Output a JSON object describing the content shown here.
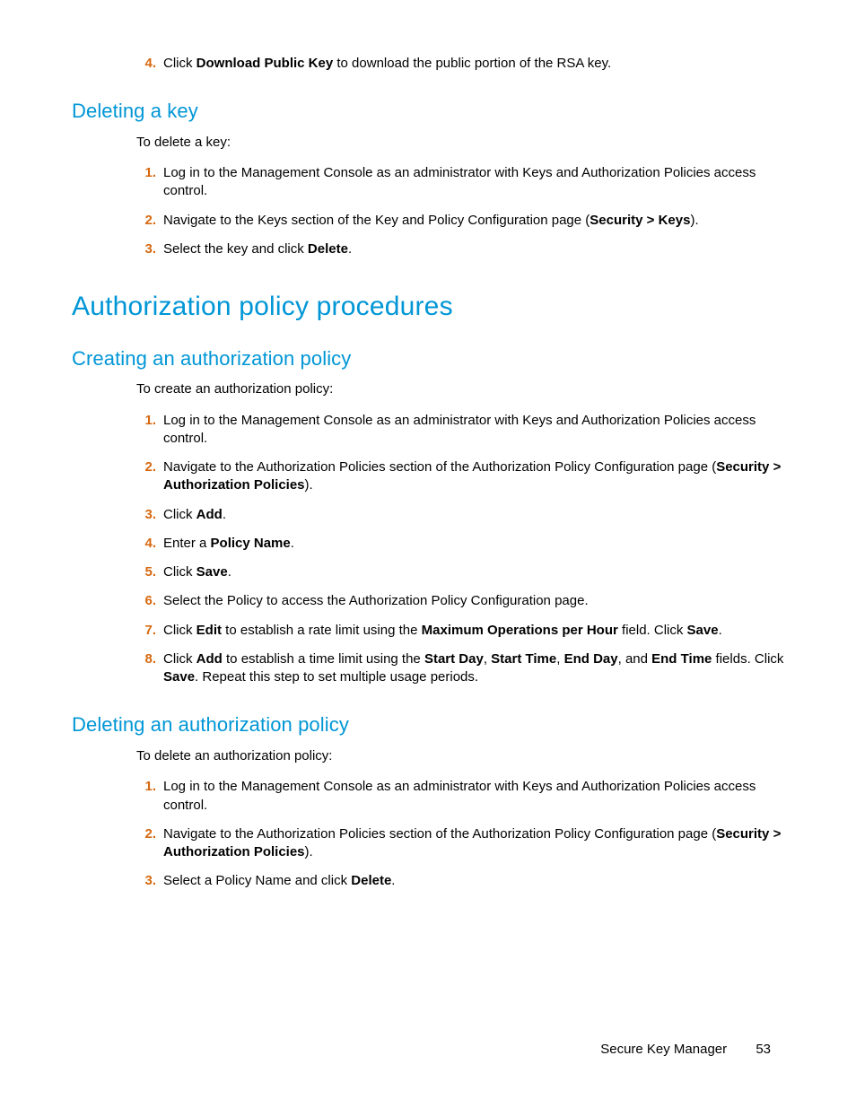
{
  "top_step": {
    "num": "4.",
    "segments": [
      {
        "t": "Click ",
        "b": false
      },
      {
        "t": "Download Public Key",
        "b": true
      },
      {
        "t": " to download the public portion of the RSA key.",
        "b": false
      }
    ]
  },
  "h2_delete_key": "Deleting a key",
  "intro_delete_key": "To delete a key:",
  "steps_delete_key": [
    {
      "num": "1.",
      "segments": [
        {
          "t": "Log in to the Management Console as an administrator with Keys and Authorization Policies access control.",
          "b": false
        }
      ]
    },
    {
      "num": "2.",
      "segments": [
        {
          "t": "Navigate to the Keys section of the Key and Policy Configuration page (",
          "b": false
        },
        {
          "t": "Security > Keys",
          "b": true
        },
        {
          "t": ").",
          "b": false
        }
      ]
    },
    {
      "num": "3.",
      "segments": [
        {
          "t": "Select the key and click ",
          "b": false
        },
        {
          "t": "Delete",
          "b": true
        },
        {
          "t": ".",
          "b": false
        }
      ]
    }
  ],
  "h1_auth": "Authorization policy procedures",
  "h2_create_auth": "Creating an authorization policy",
  "intro_create_auth": "To create an authorization policy:",
  "steps_create_auth": [
    {
      "num": "1.",
      "segments": [
        {
          "t": "Log in to the Management Console as an administrator with Keys and Authorization Policies access control.",
          "b": false
        }
      ]
    },
    {
      "num": "2.",
      "segments": [
        {
          "t": "Navigate to the Authorization Policies section of the Authorization Policy Configuration page (",
          "b": false
        },
        {
          "t": "Security > Authorization Policies",
          "b": true
        },
        {
          "t": ").",
          "b": false
        }
      ]
    },
    {
      "num": "3.",
      "segments": [
        {
          "t": "Click ",
          "b": false
        },
        {
          "t": "Add",
          "b": true
        },
        {
          "t": ".",
          "b": false
        }
      ]
    },
    {
      "num": "4.",
      "segments": [
        {
          "t": "Enter a ",
          "b": false
        },
        {
          "t": "Policy Name",
          "b": true
        },
        {
          "t": ".",
          "b": false
        }
      ]
    },
    {
      "num": "5.",
      "segments": [
        {
          "t": "Click ",
          "b": false
        },
        {
          "t": "Save",
          "b": true
        },
        {
          "t": ".",
          "b": false
        }
      ]
    },
    {
      "num": "6.",
      "segments": [
        {
          "t": "Select the Policy to access the Authorization Policy Configuration page.",
          "b": false
        }
      ]
    },
    {
      "num": "7.",
      "segments": [
        {
          "t": "Click ",
          "b": false
        },
        {
          "t": "Edit",
          "b": true
        },
        {
          "t": " to establish a rate limit using the ",
          "b": false
        },
        {
          "t": "Maximum Operations per Hour",
          "b": true
        },
        {
          "t": " field. Click ",
          "b": false
        },
        {
          "t": "Save",
          "b": true
        },
        {
          "t": ".",
          "b": false
        }
      ]
    },
    {
      "num": "8.",
      "segments": [
        {
          "t": "Click ",
          "b": false
        },
        {
          "t": "Add",
          "b": true
        },
        {
          "t": " to establish a time limit using the ",
          "b": false
        },
        {
          "t": "Start Day",
          "b": true
        },
        {
          "t": ", ",
          "b": false
        },
        {
          "t": "Start Time",
          "b": true
        },
        {
          "t": ", ",
          "b": false
        },
        {
          "t": "End Day",
          "b": true
        },
        {
          "t": ", and ",
          "b": false
        },
        {
          "t": "End Time",
          "b": true
        },
        {
          "t": " fields. Click ",
          "b": false
        },
        {
          "t": "Save",
          "b": true
        },
        {
          "t": ". Repeat this step to set multiple usage periods.",
          "b": false
        }
      ]
    }
  ],
  "h2_delete_auth": "Deleting an authorization policy",
  "intro_delete_auth": "To delete an authorization policy:",
  "steps_delete_auth": [
    {
      "num": "1.",
      "segments": [
        {
          "t": "Log in to the Management Console as an administrator with Keys and Authorization Policies access control.",
          "b": false
        }
      ]
    },
    {
      "num": "2.",
      "segments": [
        {
          "t": "Navigate to the Authorization Policies section of the Authorization Policy Configuration page (",
          "b": false
        },
        {
          "t": "Security > Authorization Policies",
          "b": true
        },
        {
          "t": ").",
          "b": false
        }
      ]
    },
    {
      "num": "3.",
      "segments": [
        {
          "t": "Select a Policy Name and click ",
          "b": false
        },
        {
          "t": "Delete",
          "b": true
        },
        {
          "t": ".",
          "b": false
        }
      ]
    }
  ],
  "footer_title": "Secure Key Manager",
  "footer_page": "53"
}
